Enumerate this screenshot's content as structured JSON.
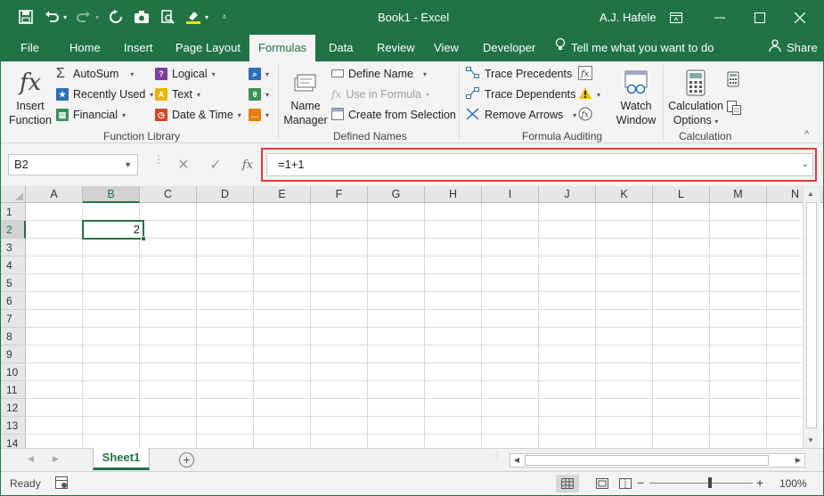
{
  "window": {
    "title": "Book1  -  Excel",
    "user": "A.J. Hafele"
  },
  "tabs": [
    {
      "label": "File"
    },
    {
      "label": "Home"
    },
    {
      "label": "Insert"
    },
    {
      "label": "Page Layout"
    },
    {
      "label": "Formulas",
      "active": true
    },
    {
      "label": "Data"
    },
    {
      "label": "Review"
    },
    {
      "label": "View"
    },
    {
      "label": "Developer"
    }
  ],
  "tell_me": "Tell me what you want to do",
  "share": "Share",
  "ribbon": {
    "function_library": {
      "label": "Function Library",
      "insert_function_l1": "Insert",
      "insert_function_l2": "Function",
      "autosum": "AutoSum",
      "recently_used": "Recently Used",
      "financial": "Financial",
      "logical": "Logical",
      "text": "Text",
      "date_time": "Date & Time"
    },
    "defined_names": {
      "label": "Defined Names",
      "name_manager_l1": "Name",
      "name_manager_l2": "Manager",
      "define_name": "Define Name",
      "use_in_formula": "Use in Formula",
      "create_from_selection": "Create from Selection"
    },
    "formula_auditing": {
      "label": "Formula Auditing",
      "trace_precedents": "Trace Precedents",
      "trace_dependents": "Trace Dependents",
      "remove_arrows": "Remove Arrows",
      "watch_window_l1": "Watch",
      "watch_window_l2": "Window"
    },
    "calculation": {
      "label": "Calculation",
      "options_l1": "Calculation",
      "options_l2": "Options"
    }
  },
  "formula_bar": {
    "name_box": "B2",
    "formula": "=1+1",
    "fx": "fx"
  },
  "grid": {
    "columns": [
      "A",
      "B",
      "C",
      "D",
      "E",
      "F",
      "G",
      "H",
      "I",
      "J",
      "K",
      "L",
      "M",
      "N"
    ],
    "rows": [
      "1",
      "2",
      "3",
      "4",
      "5",
      "6",
      "7",
      "8",
      "9",
      "10",
      "11",
      "12",
      "13",
      "14"
    ],
    "active_cell": "B2",
    "active_cell_value": "2"
  },
  "sheets": [
    {
      "name": "Sheet1",
      "active": true
    }
  ],
  "status": {
    "ready": "Ready",
    "zoom": "100%"
  },
  "colors": {
    "accent": "#217346",
    "highlight": "#e03a3a"
  }
}
